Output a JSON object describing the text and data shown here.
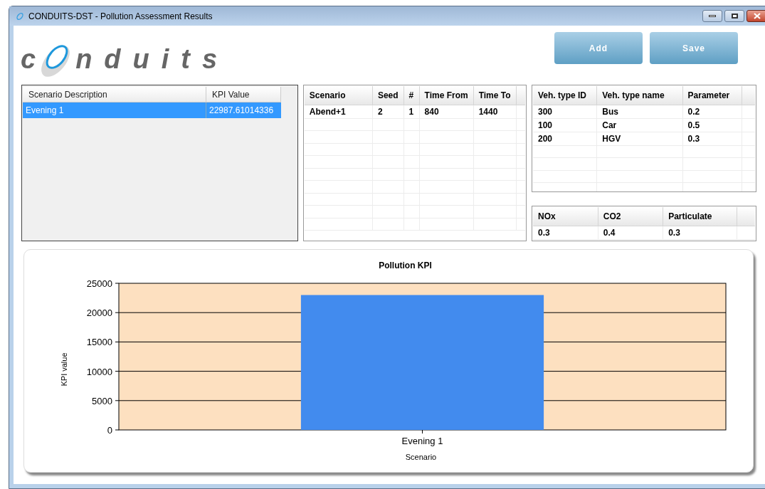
{
  "window": {
    "title": "CONDUITS-DST - Pollution Assessment Results"
  },
  "logo": {
    "before": "c",
    "after": "nduits"
  },
  "buttons": [
    {
      "label": "Add",
      "disabled": true
    },
    {
      "label": "Save",
      "disabled": true
    }
  ],
  "kpi_list": {
    "columns": [
      "Scenario Description",
      "KPI Value"
    ],
    "rows": [
      {
        "cells": [
          "Evening 1",
          "22987.61014336"
        ],
        "selected": true
      }
    ]
  },
  "scenario_grid": {
    "columns": [
      "Scenario",
      "Seed",
      "#",
      "Time From",
      "Time To"
    ],
    "rows": [
      [
        "Abend+1",
        "2",
        "1",
        "840",
        "1440"
      ]
    ]
  },
  "vehicle_grid": {
    "columns": [
      "Veh. type ID",
      "Veh. type name",
      "Parameter"
    ],
    "rows": [
      [
        "300",
        "Bus",
        "0.2"
      ],
      [
        "100",
        "Car",
        "0.5"
      ],
      [
        "200",
        "HGV",
        "0.3"
      ]
    ]
  },
  "emission_grid": {
    "columns": [
      "NOx",
      "CO2",
      "Particulate"
    ],
    "rows": [
      [
        "0.3",
        "0.4",
        "0.3"
      ]
    ]
  },
  "chart": {
    "chart_data": {
      "type": "bar",
      "title": "Pollution KPI",
      "xlabel": "Scenario",
      "ylabel": "KPI value",
      "categories": [
        "Evening 1"
      ],
      "series": [
        {
          "color": "#428bee",
          "values": [
            23000
          ]
        }
      ],
      "grid": true,
      "ylim": [
        0,
        25000
      ],
      "yticks": [
        0,
        5000,
        10000,
        15000,
        20000,
        25000
      ]
    }
  }
}
